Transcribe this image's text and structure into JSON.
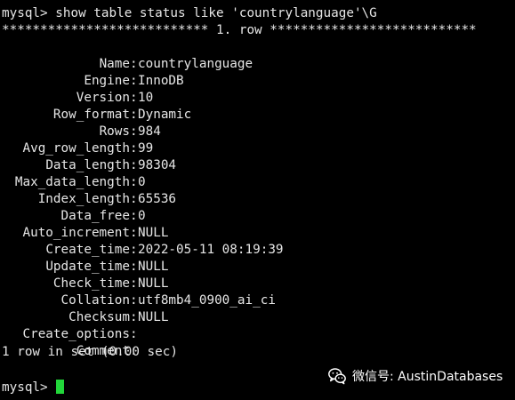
{
  "terminal": {
    "command_line": "mysql> show table status like 'countrylanguage'\\G",
    "row_header": "*************************** 1. row ***************************",
    "fields": [
      {
        "key": "Name",
        "value": "countrylanguage"
      },
      {
        "key": "Engine",
        "value": "InnoDB"
      },
      {
        "key": "Version",
        "value": "10"
      },
      {
        "key": "Row_format",
        "value": "Dynamic"
      },
      {
        "key": "Rows",
        "value": "984"
      },
      {
        "key": "Avg_row_length",
        "value": "99"
      },
      {
        "key": "Data_length",
        "value": "98304"
      },
      {
        "key": "Max_data_length",
        "value": "0"
      },
      {
        "key": "Index_length",
        "value": "65536"
      },
      {
        "key": "Data_free",
        "value": "0"
      },
      {
        "key": "Auto_increment",
        "value": "NULL"
      },
      {
        "key": "Create_time",
        "value": "2022-05-11 08:19:39"
      },
      {
        "key": "Update_time",
        "value": "NULL"
      },
      {
        "key": "Check_time",
        "value": "NULL"
      },
      {
        "key": "Collation",
        "value": "utf8mb4_0900_ai_ci"
      },
      {
        "key": "Checksum",
        "value": "NULL"
      },
      {
        "key": "Create_options",
        "value": ""
      },
      {
        "key": "Comment",
        "value": ""
      }
    ],
    "result_line": "1 row in set (0.00 sec)",
    "prompt": "mysql> ",
    "colors": {
      "background": "#000000",
      "text": "#e6e6e6",
      "cursor": "#22d63a"
    }
  },
  "watermark": {
    "text": "微信号: AustinDatabases",
    "icon": "wechat-icon"
  }
}
